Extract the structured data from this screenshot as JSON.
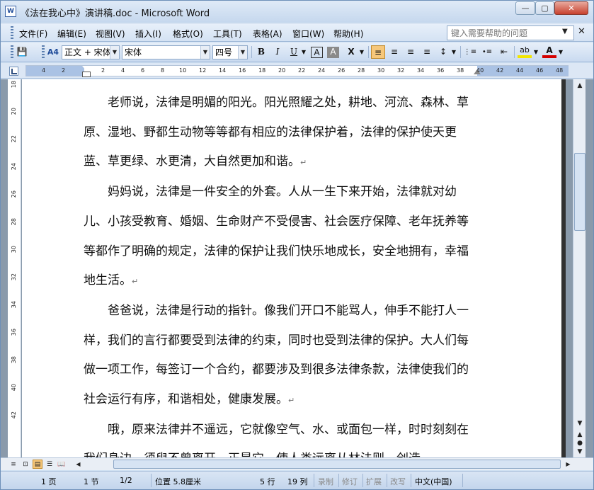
{
  "window": {
    "app_icon_text": "W",
    "title": "《法在我心中》演讲稿.doc - Microsoft Word",
    "minimize": "—",
    "maximize": "▢",
    "close": "✕"
  },
  "menu": {
    "items": [
      "文件(F)",
      "编辑(E)",
      "视图(V)",
      "插入(I)",
      "格式(O)",
      "工具(T)",
      "表格(A)",
      "窗口(W)",
      "帮助(H)"
    ],
    "help_placeholder": "键入需要帮助的问题",
    "help_arrow": "▼",
    "close_doc": "✕"
  },
  "toolbar": {
    "save_icon": "💾",
    "styles_icon": "A4",
    "style_value": "正文 + 宋体",
    "font_value": "宋体",
    "size_value": "四号",
    "bold": "B",
    "italic": "I",
    "underline": "U",
    "char_border": "A",
    "char_shading": "A",
    "char_scale": "X",
    "align_left": "≡",
    "align_center": "≡",
    "align_right": "≡",
    "justify": "≡",
    "line_spacing": "↕",
    "numbering": "⋮≡",
    "bullets": "•≡",
    "decrease_indent": "⇤",
    "highlight": "ab",
    "font_color": "A",
    "font_color_hex": "#d40000",
    "highlight_hex": "#f2e600"
  },
  "ruler": {
    "horizontal_ticks": [
      "4",
      "2",
      "2",
      "4",
      "6",
      "8",
      "10",
      "12",
      "14",
      "16",
      "18",
      "20",
      "22",
      "24",
      "26",
      "28",
      "30",
      "32",
      "34",
      "36",
      "38",
      "40",
      "42",
      "44",
      "46",
      "48"
    ],
    "vertical_ticks": [
      "18",
      "20",
      "22",
      "24",
      "26",
      "28",
      "30",
      "32",
      "34",
      "36",
      "38",
      "40",
      "42"
    ]
  },
  "document": {
    "paragraphs": [
      "老师说，法律是明媚的阳光。阳光照耀之处，耕地、河流、森林、草原、湿地、野都生动物等等都有相应的法律保护着，法律的保护使天更蓝、草更绿、水更清，大自然更加和谐。",
      "妈妈说，法律是一件安全的外套。人从一生下来开始，法律就对幼儿、小孩受教育、婚姻、生命财产不受侵害、社会医疗保障、老年抚养等等都作了明确的规定，法律的保护让我们快乐地成长，安全地拥有，幸福地生活。",
      "爸爸说，法律是行动的指针。像我们开口不能骂人，伸手不能打人一样，我们的言行都要受到法律的约束，同时也受到法律的保护。大人们每做一项工作，每签订一个合约，都要涉及到很多法律条款，法律使我们的社会运行有序，和谐相处，健康发展。",
      "哦，原来法律并不遥远，它就像空气、水、或面包一样，时时刻刻在我们身边，须臾不曾离开。正是它，使人类远离从林法则，创造"
    ],
    "paragraph_mark": "↵"
  },
  "statusbar": {
    "page": "1 页",
    "section": "1 节",
    "page_of": "1/2",
    "position": "位置 5.8厘米",
    "line": "5 行",
    "column": "19 列",
    "rec": "录制",
    "trk": "修订",
    "ext": "扩展",
    "ovr": "改写",
    "language": "中文(中国)"
  },
  "scroll": {
    "up": "▲",
    "down": "▼",
    "left": "◀",
    "right": "▶",
    "prev_page": "▲",
    "select_browse": "●",
    "next_page": "▼"
  },
  "views": {
    "normal": "≡",
    "web": "⊡",
    "print": "▤",
    "outline": "☰",
    "reading": "📖"
  }
}
